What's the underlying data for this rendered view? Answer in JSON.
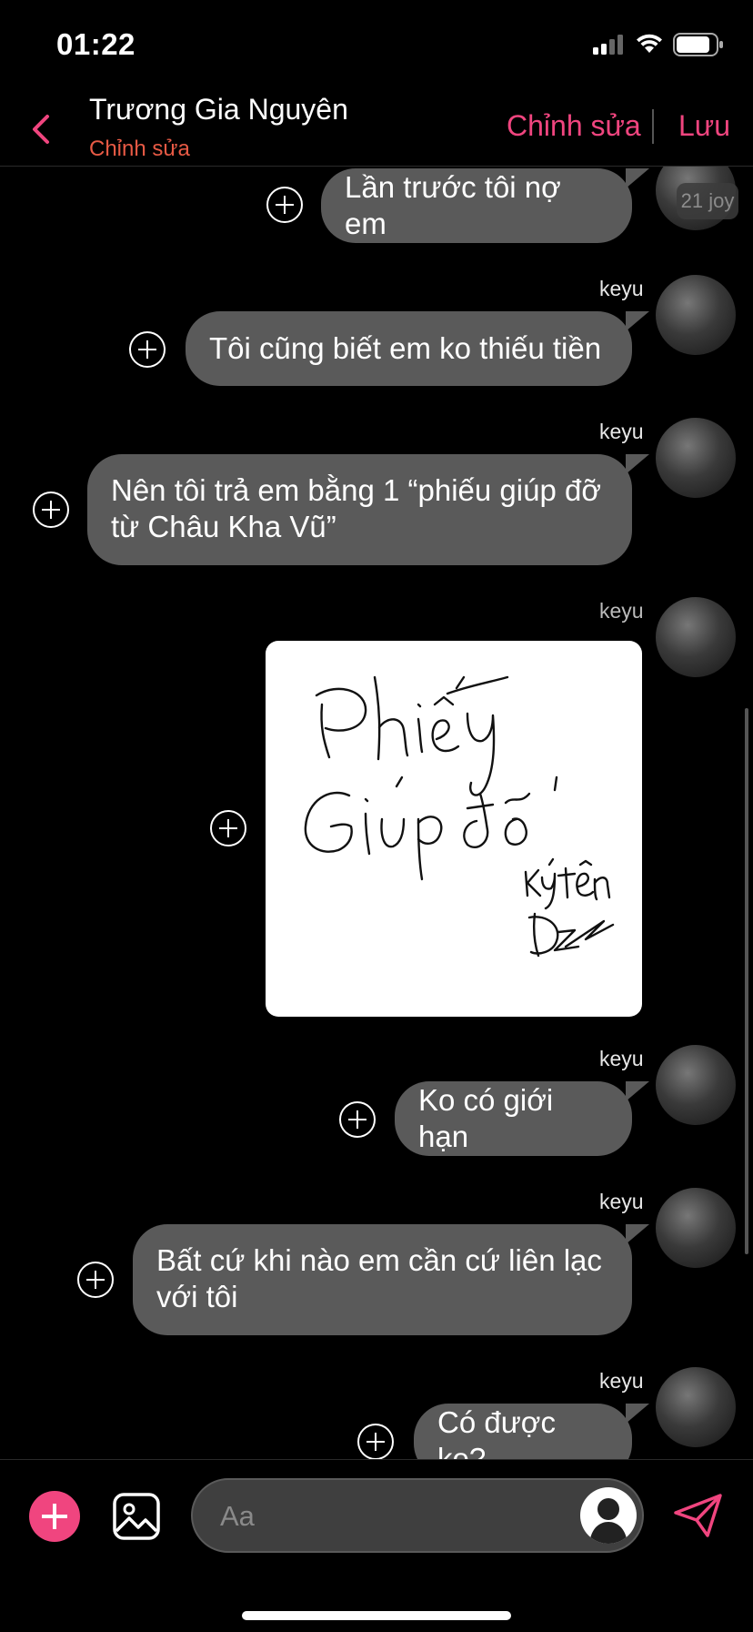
{
  "status_bar": {
    "time": "01:22"
  },
  "header": {
    "contact_name": "Trương Gia Nguyên",
    "subtitle": "Chỉnh sửa",
    "edit_label": "Chỉnh sửa",
    "save_label": "Lưu"
  },
  "messages": [
    {
      "sender": "",
      "text": "Lần trước tôi nợ em",
      "time_badge": "21 joy"
    },
    {
      "sender": "keyu",
      "text": "Tôi cũng biết em ko thiếu tiền"
    },
    {
      "sender": "keyu",
      "text_line1": "Nên tôi trả em bằng 1 “phiếu giúp đỡ",
      "text_line2": "từ Châu Kha Vũ”"
    },
    {
      "sender": "keyu",
      "image": "handwritten-voucher",
      "image_text": [
        "Phiếu",
        "Giúp đỡ",
        "Ký tên",
        "Dz"
      ]
    },
    {
      "sender": "keyu",
      "text": "Ko có giới hạn"
    },
    {
      "sender": "keyu",
      "text_line1": "Bất cứ khi nào em cần cứ liên lạc",
      "text_line2": "với tôi"
    },
    {
      "sender": "keyu",
      "text": "Có được ko?"
    }
  ],
  "composer": {
    "placeholder": "Aa"
  },
  "icons": {
    "back": "chevron-left-icon",
    "add": "plus-icon",
    "image": "image-icon",
    "send": "send-icon",
    "react": "plus-circle-icon"
  },
  "colors": {
    "accent": "#f0457f",
    "subtitle": "#e85a45",
    "bubble": "#5a5a5a",
    "background": "#000000"
  }
}
